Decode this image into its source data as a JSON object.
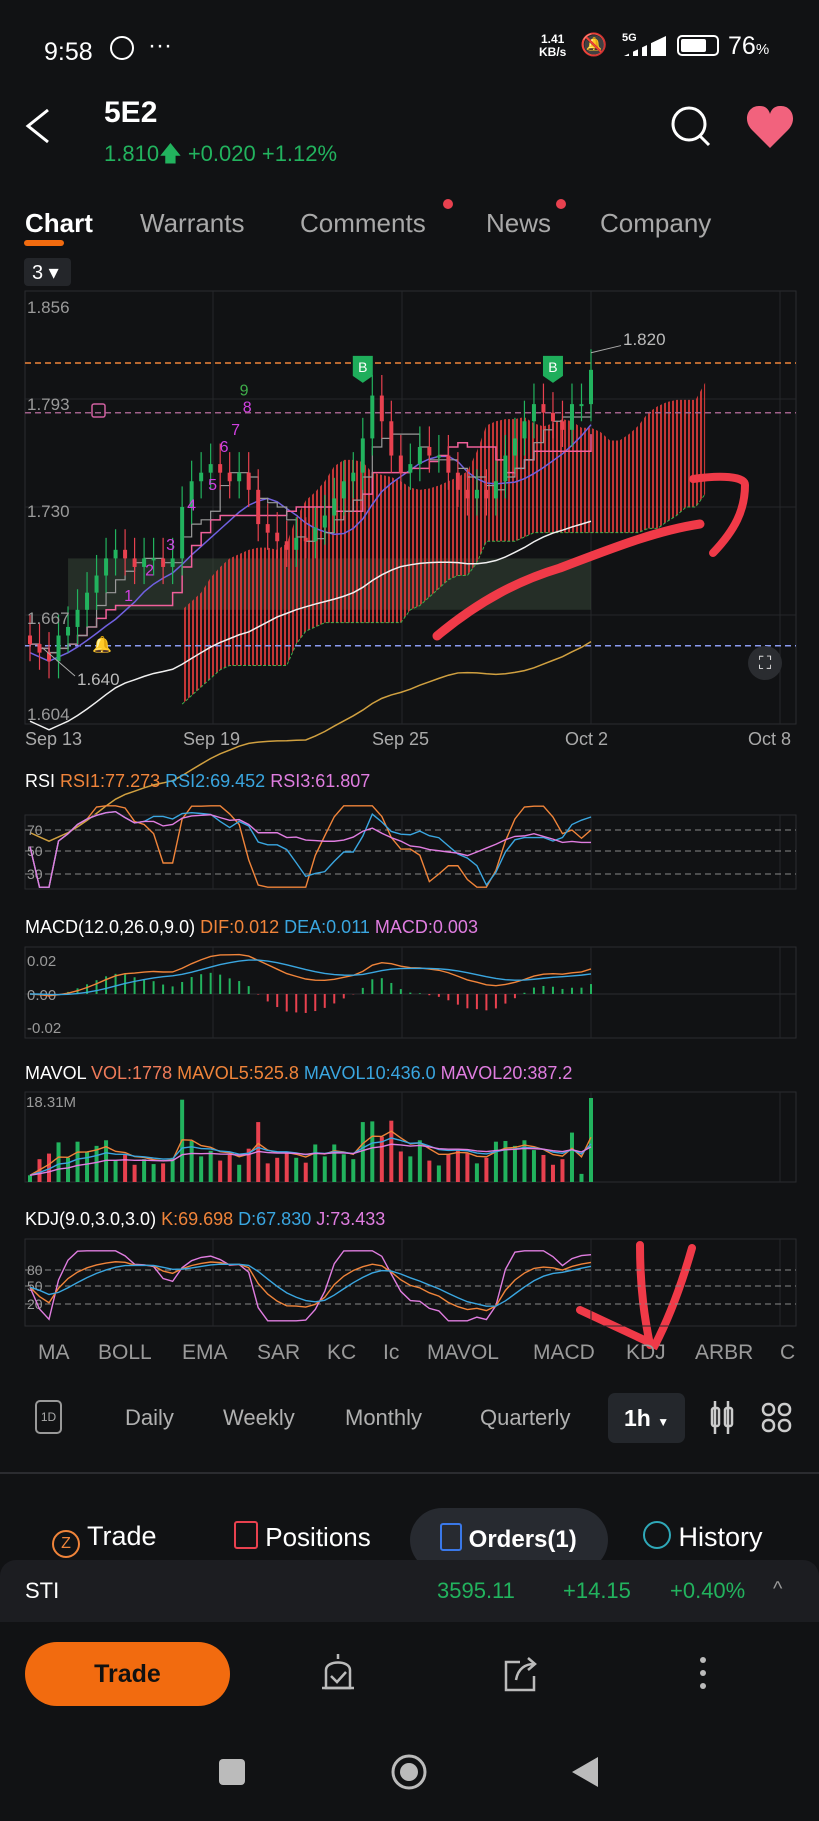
{
  "status": {
    "time": "9:58",
    "net_speed": "1.41",
    "net_unit": "KB/s",
    "network": "5G",
    "battery": "76",
    "battery_unit": "%"
  },
  "header": {
    "symbol": "5E2",
    "price": "1.810",
    "change": "+0.020",
    "change_pct": "+1.12%"
  },
  "tabs": [
    {
      "label": "Chart",
      "active": true
    },
    {
      "label": "Warrants"
    },
    {
      "label": "Comments",
      "dot": true
    },
    {
      "label": "News",
      "dot": true
    },
    {
      "label": "Company"
    }
  ],
  "chart": {
    "layout_selector": "3",
    "y_ticks": [
      "1.856",
      "1.793",
      "1.730",
      "1.667",
      "1.604"
    ],
    "x_ticks": [
      "Sep 13",
      "Sep 19",
      "Sep 25",
      "Oct 2",
      "Oct 8"
    ],
    "high_label": "1.820",
    "low_label": "1.640",
    "marker_buy": "B",
    "colors": {
      "up": "#22b35e",
      "down": "#e8414f",
      "accent": "#f26b0f"
    },
    "closes": [
      1.65,
      1.645,
      1.64,
      1.655,
      1.66,
      1.67,
      1.68,
      1.69,
      1.7,
      1.705,
      1.7,
      1.695,
      1.7,
      1.7,
      1.695,
      1.7,
      1.73,
      1.745,
      1.75,
      1.755,
      1.75,
      1.745,
      1.75,
      1.74,
      1.72,
      1.715,
      1.71,
      1.705,
      1.712,
      1.71,
      1.718,
      1.725,
      1.735,
      1.745,
      1.75,
      1.77,
      1.795,
      1.78,
      1.76,
      1.75,
      1.755,
      1.765,
      1.76,
      1.76,
      1.75,
      1.74,
      1.735,
      1.74,
      1.735,
      1.745,
      1.76,
      1.77,
      1.78,
      1.79,
      1.785,
      1.78,
      1.775,
      1.79,
      1.79,
      1.81
    ],
    "td_counts": [
      "1",
      "2",
      "3",
      "4",
      "5",
      "6",
      "7",
      "8",
      "9"
    ]
  },
  "rsi": {
    "title": "RSI",
    "rsi1": "RSI1:77.273",
    "rsi2": "RSI2:69.452",
    "rsi3": "RSI3:61.807",
    "levels": [
      "70",
      "50",
      "30"
    ]
  },
  "macd": {
    "title": "MACD(12.0,26.0,9.0)",
    "dif": "DIF:0.012",
    "dea": "DEA:0.011",
    "macd": "MACD:0.003",
    "levels": [
      "0.02",
      "0.00",
      "-0.02"
    ]
  },
  "mavol": {
    "title": "MAVOL",
    "vol": "VOL:1778",
    "mavol5": "MAVOL5:525.8",
    "mavol10": "MAVOL10:436.0",
    "mavol20": "MAVOL20:387.2",
    "max": "18.31M"
  },
  "kdj": {
    "title": "KDJ(9.0,3.0,3.0)",
    "k": "K:69.698",
    "d": "D:67.830",
    "j": "J:73.433",
    "levels": [
      "80",
      "50",
      "20"
    ]
  },
  "indicators": [
    {
      "label": "MA"
    },
    {
      "label": "BOLL"
    },
    {
      "label": "EMA",
      "active": true
    },
    {
      "label": "SAR"
    },
    {
      "label": "KC"
    },
    {
      "label": "Ic",
      "active": true
    },
    {
      "label": "MAVOL",
      "active": true
    },
    {
      "label": "MACD",
      "active": true
    },
    {
      "label": "KDJ",
      "active": true
    },
    {
      "label": "ARBR"
    },
    {
      "label": "C"
    }
  ],
  "periods": {
    "intraday_icon": "1D",
    "items": [
      "Daily",
      "Weekly",
      "Monthly",
      "Quarterly"
    ],
    "selected": "1h"
  },
  "trade_tabs": [
    {
      "label": "Trade",
      "icon": "trade-icon"
    },
    {
      "label": "Positions",
      "icon": "briefcase-icon"
    },
    {
      "label": "Orders(1)",
      "icon": "clipboard-icon",
      "active": true
    },
    {
      "label": "History",
      "icon": "clock-icon"
    }
  ],
  "index_bar": {
    "name": "STI",
    "value": "3595.11",
    "change": "+14.15",
    "change_pct": "+0.40%"
  },
  "bottom": {
    "trade_button": "Trade"
  }
}
